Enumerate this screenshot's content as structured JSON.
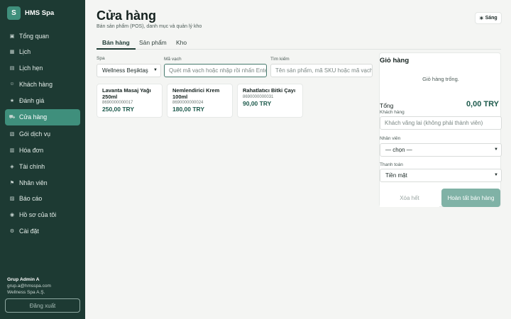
{
  "brand": {
    "logo_letter": "S",
    "name": "HMS Spa"
  },
  "sidebar": {
    "items": [
      {
        "icon": "▣",
        "label": "Tổng quan"
      },
      {
        "icon": "▦",
        "label": "Lịch"
      },
      {
        "icon": "▤",
        "label": "Lịch hẹn"
      },
      {
        "icon": "☺",
        "label": "Khách hàng"
      },
      {
        "icon": "★",
        "label": "Đánh giá"
      },
      {
        "icon": "⛟",
        "label": "Cửa hàng"
      },
      {
        "icon": "▧",
        "label": "Gói dịch vụ"
      },
      {
        "icon": "▥",
        "label": "Hóa đơn"
      },
      {
        "icon": "◈",
        "label": "Tài chính"
      },
      {
        "icon": "⚑",
        "label": "Nhân viên"
      },
      {
        "icon": "▨",
        "label": "Báo cáo"
      },
      {
        "icon": "◉",
        "label": "Hồ sơ của tôi"
      },
      {
        "icon": "⚙",
        "label": "Cài đặt"
      }
    ],
    "active_index": 5,
    "user": {
      "name": "Grup Admin A",
      "email": "grup.a@hmsspa.com",
      "org": "Wellness Spa A.Ş."
    },
    "logout_label": "Đăng xuất"
  },
  "header": {
    "title": "Cửa hàng",
    "subtitle": "Bán sản phẩm (POS), danh mục và quản lý kho",
    "theme_icon": "☀",
    "theme_label": "Sáng"
  },
  "tabs": [
    "Bán hàng",
    "Sản phẩm",
    "Kho"
  ],
  "filters": {
    "spa_label": "Spa",
    "spa_value": "Wellness Beşiktaş",
    "barcode_label": "Mã vạch",
    "barcode_placeholder": "Quét mã vạch hoặc nhập rồi nhấn Enter",
    "search_label": "Tìm kiếm",
    "search_placeholder": "Tên sản phẩm, mã SKU hoặc mã vạch"
  },
  "products": [
    {
      "name": "Lavanta Masaj Yağı 250ml",
      "sku": "8690000000017",
      "price": "250,00 TRY"
    },
    {
      "name": "Nemlendirici Krem 100ml",
      "sku": "8690000000024",
      "price": "180,00 TRY"
    },
    {
      "name": "Rahatlatıcı Bitki Çayı",
      "sku": "8690000000031",
      "price": "90,00 TRY"
    }
  ],
  "cart": {
    "title": "Giỏ hàng",
    "empty_text": "Giỏ hàng trống.",
    "total_label": "Tổng",
    "total_value": "0,00 TRY",
    "customer_label": "Khách hàng",
    "customer_placeholder": "Khách vãng lai (không phải thành viên)",
    "staff_label": "Nhân viên",
    "staff_value": "— chọn —",
    "payment_label": "Thanh toán",
    "payment_value": "Tiền mặt",
    "clear_label": "Xóa hết",
    "finish_label": "Hoàn tất bán hàng"
  }
}
